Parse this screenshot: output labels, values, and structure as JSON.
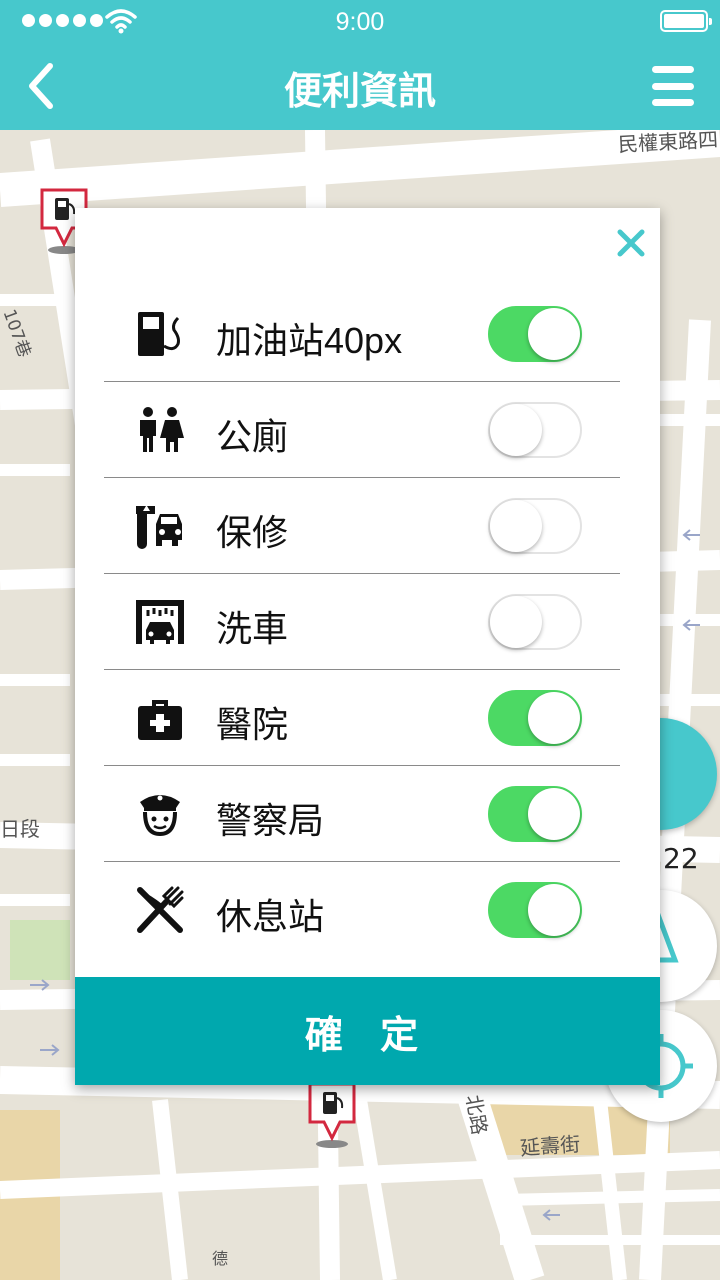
{
  "status": {
    "time": "9:00"
  },
  "header": {
    "title": "便利資訊",
    "back_icon": "chevron-left-icon",
    "menu_icon": "hamburger-menu-icon"
  },
  "map": {
    "street_labels": [
      "民權東路四",
      "107巷",
      "日段",
      "22",
      "北路",
      "延壽街",
      "德"
    ]
  },
  "dialog": {
    "items": [
      {
        "label": "加油站40px",
        "icon": "gas-station-icon",
        "enabled": true
      },
      {
        "label": "公廁",
        "icon": "restroom-icon",
        "enabled": false
      },
      {
        "label": "保修",
        "icon": "car-repair-icon",
        "enabled": false
      },
      {
        "label": "洗車",
        "icon": "car-wash-icon",
        "enabled": false
      },
      {
        "label": "醫院",
        "icon": "first-aid-kit-icon",
        "enabled": true
      },
      {
        "label": "警察局",
        "icon": "police-officer-icon",
        "enabled": true
      },
      {
        "label": "休息站",
        "icon": "fork-knife-icon",
        "enabled": true
      }
    ],
    "confirm_label": "確 定"
  },
  "colors": {
    "header": "#47c8cc",
    "confirm": "#00a8ae",
    "toggle_on": "#4cd964",
    "marker": "#d3283f"
  }
}
